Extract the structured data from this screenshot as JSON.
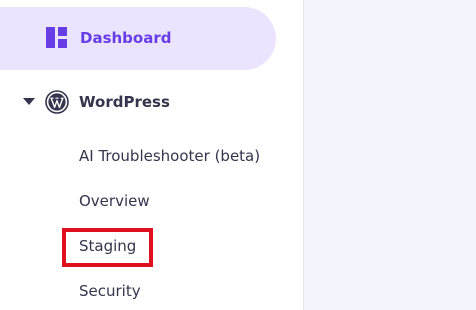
{
  "sidebar": {
    "dashboard": {
      "label": "Dashboard",
      "icon": "dashboard-grid-icon",
      "active": true
    },
    "wordpress": {
      "label": "WordPress",
      "icon": "wordpress-logo-icon",
      "expanded": true,
      "items": [
        {
          "label": "AI Troubleshooter (beta)"
        },
        {
          "label": "Overview"
        },
        {
          "label": "Staging",
          "highlighted": true
        },
        {
          "label": "Security"
        }
      ]
    }
  },
  "colors": {
    "accent": "#673de6",
    "active_bg": "#ebe4ff",
    "text": "#36344d",
    "highlight_box": "#e0101f",
    "content_bg": "#f4f4fc"
  }
}
